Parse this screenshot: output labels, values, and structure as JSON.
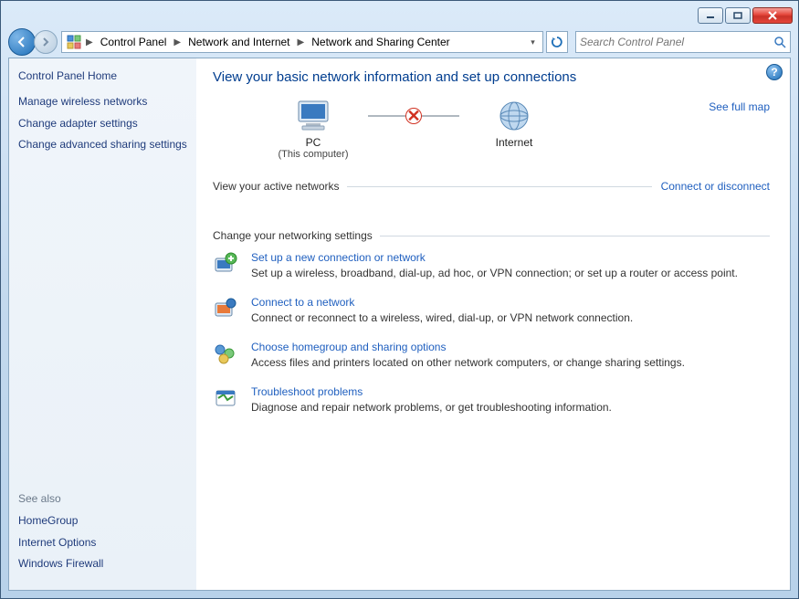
{
  "breadcrumbs": [
    "Control Panel",
    "Network and Internet",
    "Network and Sharing Center"
  ],
  "search": {
    "placeholder": "Search Control Panel"
  },
  "sidebar": {
    "home": "Control Panel Home",
    "links": [
      "Manage wireless networks",
      "Change adapter settings",
      "Change advanced sharing settings"
    ],
    "seealso_label": "See also",
    "seealso_links": [
      "HomeGroup",
      "Internet Options",
      "Windows Firewall"
    ]
  },
  "page": {
    "title": "View your basic network information and set up connections",
    "fullmap": "See full map",
    "nodes": {
      "pc_label": "PC",
      "pc_sub": "(This computer)",
      "internet_label": "Internet"
    },
    "active_label": "View your active networks",
    "connect_link": "Connect or disconnect",
    "settings_label": "Change your networking settings",
    "settings": [
      {
        "title": "Set up a new connection or network",
        "desc": "Set up a wireless, broadband, dial-up, ad hoc, or VPN connection; or set up a router or access point."
      },
      {
        "title": "Connect to a network",
        "desc": "Connect or reconnect to a wireless, wired, dial-up, or VPN network connection."
      },
      {
        "title": "Choose homegroup and sharing options",
        "desc": "Access files and printers located on other network computers, or change sharing settings."
      },
      {
        "title": "Troubleshoot problems",
        "desc": "Diagnose and repair network problems, or get troubleshooting information."
      }
    ]
  }
}
